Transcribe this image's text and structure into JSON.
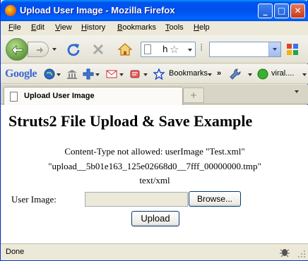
{
  "window": {
    "title": "Upload User Image - Mozilla Firefox",
    "minimize_glyph": "_",
    "maximize_glyph": "□",
    "close_glyph": "✕"
  },
  "menubar": {
    "items": [
      "File",
      "Edit",
      "View",
      "History",
      "Bookmarks",
      "Tools",
      "Help"
    ]
  },
  "navbar": {
    "url_text": "h",
    "star_glyph": "☆",
    "resizer_glyph": "⁞"
  },
  "bookmarks_bar": {
    "google_logo": "Google",
    "bookmarks_label": "Bookmarks",
    "overflow": "»",
    "user_label": "viral...."
  },
  "tabs": {
    "active_label": "Upload User Image",
    "new_tab_glyph": "+"
  },
  "page": {
    "heading": "Struts2 File Upload & Save Example",
    "error_line_1": "Content-Type not allowed: userImage \"Test.xml\"",
    "error_line_2": "\"upload__5b01e163_125e02668d0__7fff_00000000.tmp\"",
    "error_line_3": "text/xml",
    "field_label": "User Image:",
    "file_value": "",
    "browse_label": "Browse...",
    "upload_label": "Upload"
  },
  "statusbar": {
    "text": "Done"
  },
  "colors": {
    "titlebar": "#0054e3",
    "close_button": "#c7391b",
    "button_border": "#003c74"
  }
}
